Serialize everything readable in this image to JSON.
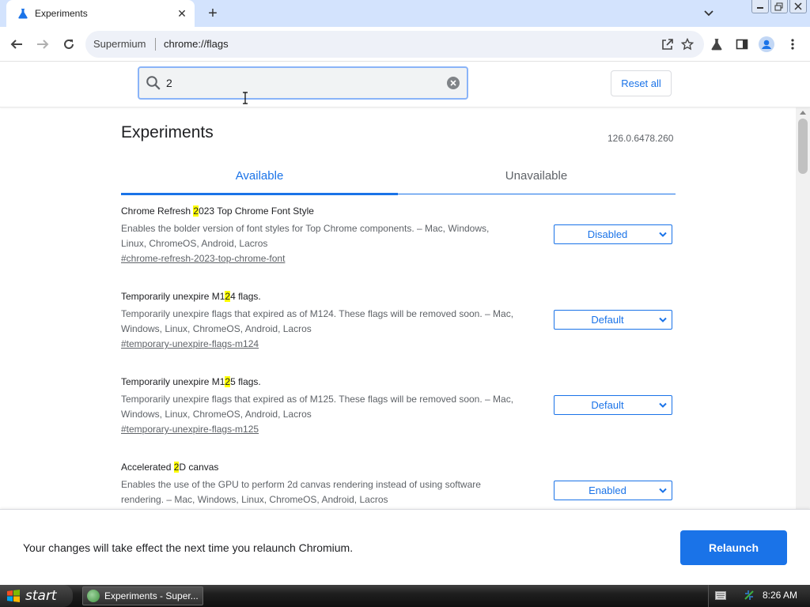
{
  "browser": {
    "tab_title": "Experiments",
    "omnibox_site": "Supermium",
    "omnibox_url": "chrome://flags"
  },
  "header": {
    "search_value": "2",
    "reset_label": "Reset all"
  },
  "page": {
    "title": "Experiments",
    "version": "126.0.6478.260",
    "tabs": [
      {
        "label": "Available",
        "selected": true
      },
      {
        "label": "Unavailable",
        "selected": false
      }
    ]
  },
  "experiments": [
    {
      "title_pre": "Chrome Refresh ",
      "title_match": "2",
      "title_post": "023 Top Chrome Font Style",
      "desc_1": "Enables the bolder version of font styles for Top Chrome components. – Mac, Windows,",
      "desc_2": "Linux, ChromeOS, Android, Lacros",
      "link": "#chrome-refresh-2023-top-chrome-font",
      "value": "Disabled"
    },
    {
      "title_pre": "Temporarily unexpire M1",
      "title_match": "2",
      "title_post": "4 flags.",
      "desc_1": "Temporarily unexpire flags that expired as of M124. These flags will be removed soon. – Mac,",
      "desc_2": "Windows, Linux, ChromeOS, Android, Lacros",
      "link": "#temporary-unexpire-flags-m124",
      "value": "Default"
    },
    {
      "title_pre": "Temporarily unexpire M1",
      "title_match": "2",
      "title_post": "5 flags.",
      "desc_1": "Temporarily unexpire flags that expired as of M125. These flags will be removed soon. – Mac,",
      "desc_2": "Windows, Linux, ChromeOS, Android, Lacros",
      "link": "#temporary-unexpire-flags-m125",
      "value": "Default"
    },
    {
      "title_pre": "Accelerated ",
      "title_match": "2",
      "title_post": "D canvas",
      "desc_1": "Enables the use of the GPU to perform 2d canvas rendering instead of using software",
      "desc_2": "rendering. – Mac, Windows, Linux, ChromeOS, Android, Lacros",
      "link": "",
      "value": "Enabled"
    }
  ],
  "relaunch": {
    "message": "Your changes will take effect the next time you relaunch Chromium.",
    "button": "Relaunch"
  },
  "taskbar": {
    "start_label": "start",
    "task_label": "Experiments - Super...",
    "clock": "8:26 AM"
  },
  "colors": {
    "accent": "#1a73e8",
    "highlight": "#ffff00",
    "tabstrip": "#d3e3fd"
  }
}
